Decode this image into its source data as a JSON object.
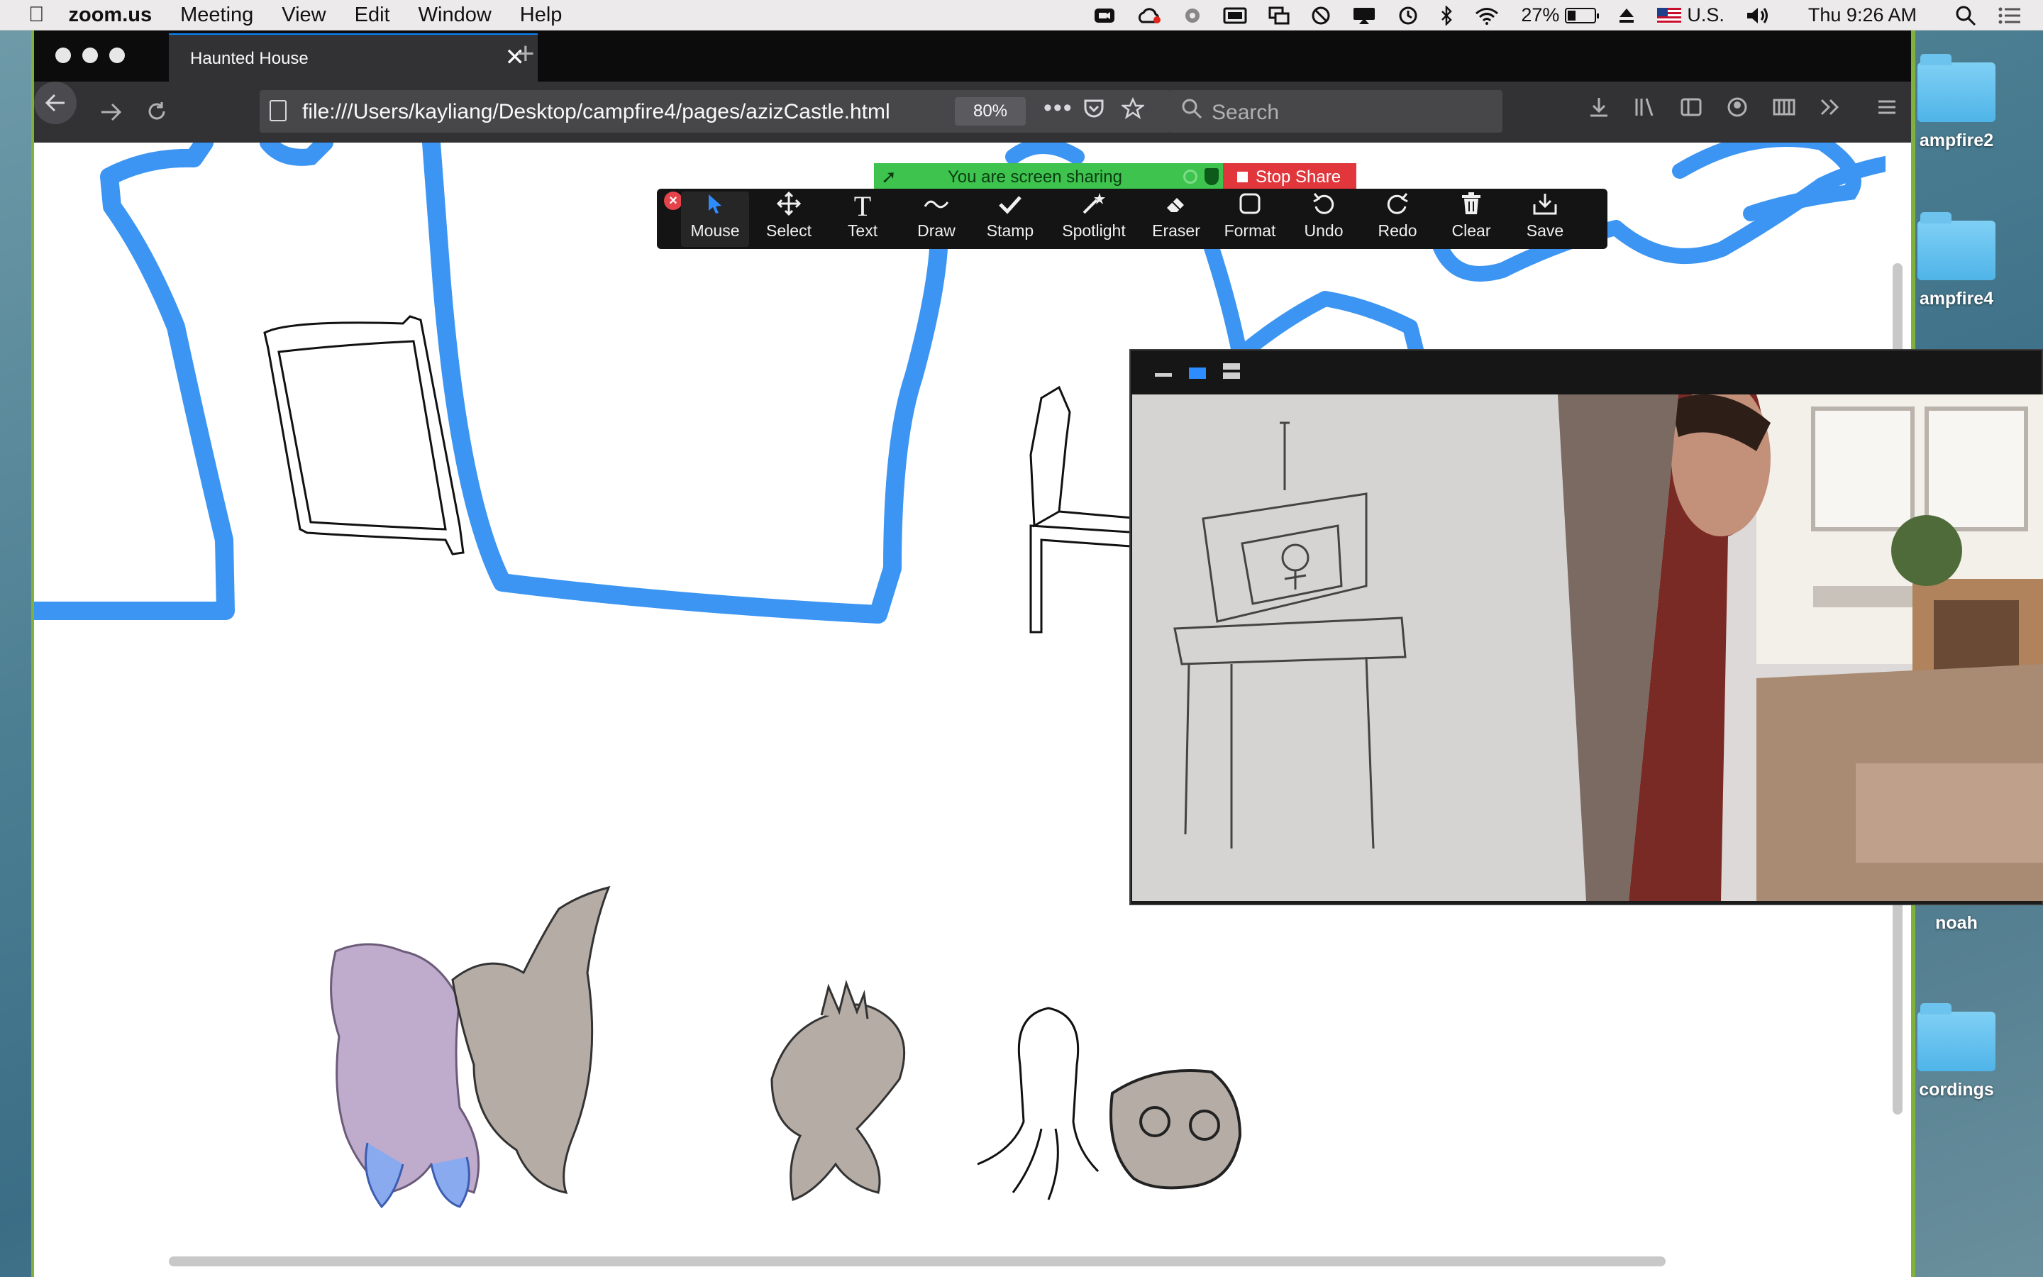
{
  "menubar": {
    "app_name": "zoom.us",
    "menus": [
      "Meeting",
      "View",
      "Edit",
      "Window",
      "Help"
    ],
    "battery": "27%",
    "input_source": "U.S.",
    "clock": "Thu 9:26 AM"
  },
  "desktop": {
    "folders": [
      "ampfire2",
      "ampfire4",
      "noah",
      "cordings"
    ]
  },
  "browser": {
    "tab_title": "Haunted House",
    "url": "file:///Users/kayliang/Desktop/campfire4/pages/azizCastle.html",
    "zoom": "80%",
    "search_placeholder": "Search"
  },
  "zoom_share": {
    "banner_text": "You are screen sharing",
    "stop_label": "Stop Share"
  },
  "annotation_tools": [
    {
      "label": "Mouse",
      "icon": "mouse-pointer-icon",
      "active": true
    },
    {
      "label": "Select",
      "icon": "move-arrows-icon"
    },
    {
      "label": "Text",
      "icon": "text-icon"
    },
    {
      "label": "Draw",
      "icon": "squiggle-icon"
    },
    {
      "label": "Stamp",
      "icon": "checkmark-icon"
    },
    {
      "label": "Spotlight",
      "icon": "magic-wand-icon"
    },
    {
      "label": "Eraser",
      "icon": "eraser-icon"
    },
    {
      "label": "Format",
      "icon": "square-icon"
    },
    {
      "label": "Undo",
      "icon": "undo-icon"
    },
    {
      "label": "Redo",
      "icon": "redo-icon"
    },
    {
      "label": "Clear",
      "icon": "trash-icon"
    },
    {
      "label": "Save",
      "icon": "save-icon"
    }
  ],
  "colors": {
    "zoom_accent": "#2d8cff",
    "share_green": "#3ec34e",
    "stop_red": "#e0363c",
    "drawing_blue": "#3c95f2",
    "window_border_green": "#80b13a"
  }
}
